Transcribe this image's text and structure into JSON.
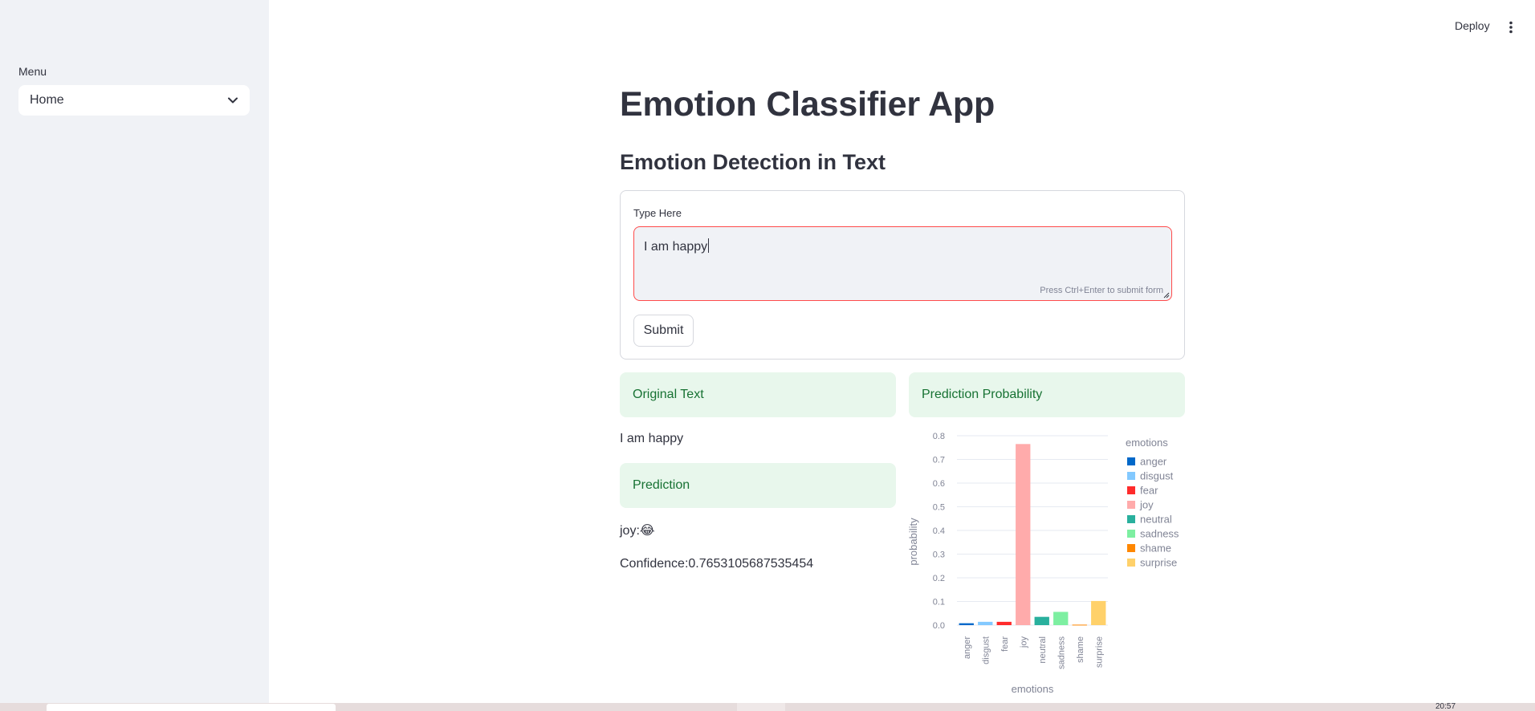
{
  "sidebar": {
    "menu_label": "Menu",
    "menu_value": "Home"
  },
  "topbar": {
    "deploy_label": "Deploy",
    "more_icon": "vertical-ellipsis-icon"
  },
  "main": {
    "title": "Emotion Classifier App",
    "subtitle": "Emotion Detection in Text",
    "form": {
      "input_label": "Type Here",
      "input_value": "I am happy",
      "hint": "Press Ctrl+Enter to submit form",
      "submit_label": "Submit"
    },
    "left_column": {
      "original_header": "Original Text",
      "original_value": "I am happy",
      "prediction_header": "Prediction",
      "prediction_value": "joy:😂",
      "confidence_value": "Confidence:0.7653105687535454"
    },
    "right_column": {
      "probability_header": "Prediction Probability"
    }
  },
  "chart_data": {
    "type": "bar",
    "xlabel": "emotions",
    "ylabel": "probability",
    "legend_title": "emotions",
    "legend_position": "right",
    "ylim": [
      0,
      0.8
    ],
    "yticks": [
      "0.0",
      "0.1",
      "0.2",
      "0.3",
      "0.4",
      "0.5",
      "0.6",
      "0.7",
      "0.8"
    ],
    "categories": [
      "anger",
      "disgust",
      "fear",
      "joy",
      "neutral",
      "sadness",
      "shame",
      "surprise"
    ],
    "values": [
      0.008,
      0.014,
      0.014,
      0.765,
      0.035,
      0.056,
      0.002,
      0.102
    ],
    "colors": [
      "#0068c9",
      "#83c9ff",
      "#ff2b2b",
      "#ffabab",
      "#29b09d",
      "#7defa1",
      "#ff8700",
      "#ffd16a"
    ],
    "grid": true
  },
  "taskbar": {
    "clock": "20:57"
  }
}
